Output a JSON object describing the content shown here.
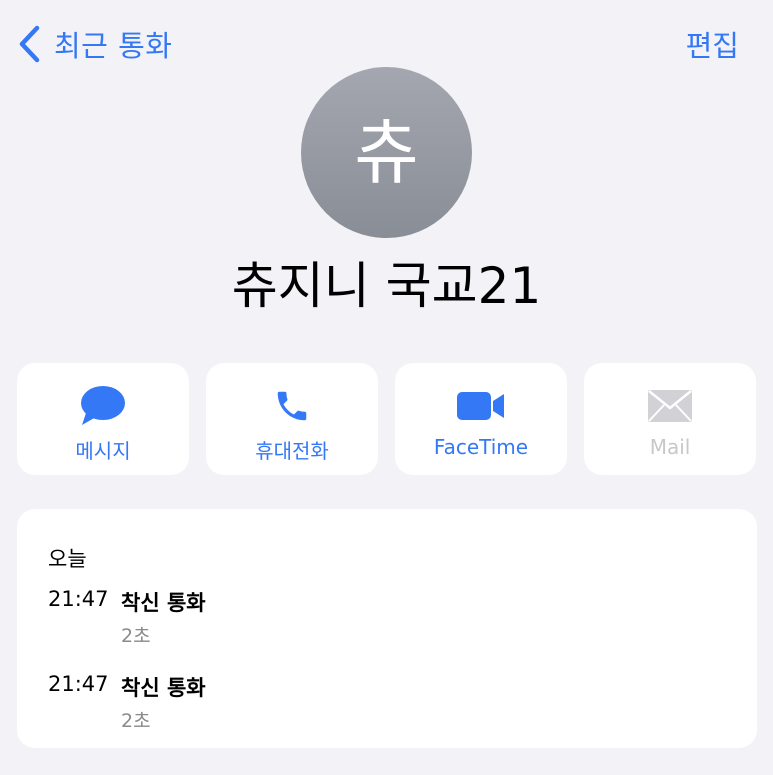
{
  "nav": {
    "back_label": "최근 통화",
    "edit_label": "편집"
  },
  "contact": {
    "initial": "츄",
    "name": "츄지니 국교21"
  },
  "actions": [
    {
      "label": "메시지",
      "icon": "message-bubble-icon",
      "enabled": true
    },
    {
      "label": "휴대전화",
      "icon": "phone-icon",
      "enabled": true
    },
    {
      "label": "FaceTime",
      "icon": "video-camera-icon",
      "enabled": true
    },
    {
      "label": "Mail",
      "icon": "envelope-icon",
      "enabled": false
    }
  ],
  "history": {
    "date_label": "오늘",
    "calls": [
      {
        "time": "21:47",
        "type": "착신 통화",
        "duration": "2초"
      },
      {
        "time": "21:47",
        "type": "착신 통화",
        "duration": "2초"
      }
    ]
  },
  "colors": {
    "accent": "#3478f6",
    "background": "#f2f2f7",
    "disabled": "#c7c7cc",
    "secondary_text": "#8a8a8e"
  }
}
